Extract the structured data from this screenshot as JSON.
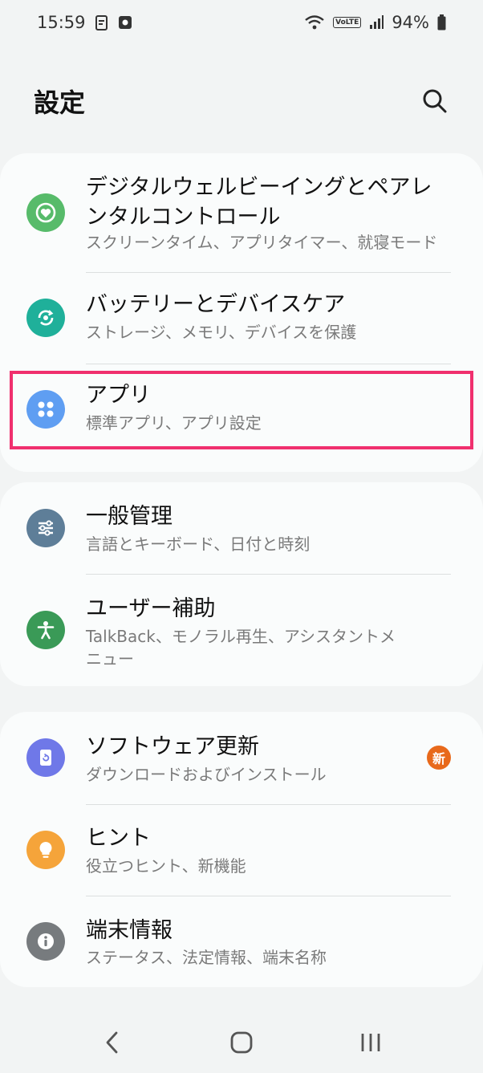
{
  "status": {
    "time": "15:59",
    "volte": "VoLTE",
    "battery": "94%"
  },
  "header": {
    "title": "設定"
  },
  "groups": [
    {
      "items": [
        {
          "title": "デジタルウェルビーイングとペアレンタルコントロール",
          "subtitle": "スクリーンタイム、アプリタイマー、就寝モード",
          "icon": "wellbeing-icon",
          "color": "#57bb6a"
        },
        {
          "title": "バッテリーとデバイスケア",
          "subtitle": "ストレージ、メモリ、デバイスを保護",
          "icon": "device-care-icon",
          "color": "#1fb09a"
        },
        {
          "title": "アプリ",
          "subtitle": "標準アプリ、アプリ設定",
          "icon": "apps-icon",
          "color": "#5f9ef2"
        }
      ]
    },
    {
      "items": [
        {
          "title": "一般管理",
          "subtitle": "言語とキーボード、日付と時刻",
          "icon": "sliders-icon",
          "color": "#5e7e98"
        },
        {
          "title": "ユーザー補助",
          "subtitle": "TalkBack、モノラル再生、アシスタントメニュー",
          "icon": "accessibility-icon",
          "color": "#3a9a57"
        }
      ]
    },
    {
      "items": [
        {
          "title": "ソフトウェア更新",
          "subtitle": "ダウンロードおよびインストール",
          "icon": "software-update-icon",
          "color": "#6f78e8",
          "badge": "新"
        },
        {
          "title": "ヒント",
          "subtitle": "役立つヒント、新機能",
          "icon": "lightbulb-icon",
          "color": "#f5a43a"
        },
        {
          "title": "端末情報",
          "subtitle": "ステータス、法定情報、端末名称",
          "icon": "info-icon",
          "color": "#777b7e"
        }
      ]
    }
  ],
  "colors": {
    "highlight": "#f0306e",
    "background": "#f2f4f4",
    "card": "#fafcfc"
  }
}
